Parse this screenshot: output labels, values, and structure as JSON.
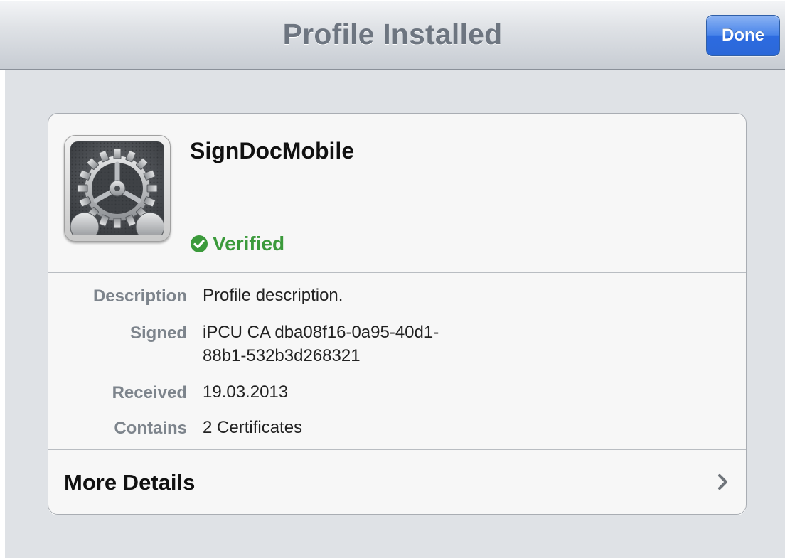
{
  "navbar": {
    "title": "Profile Installed",
    "done_label": "Done"
  },
  "profile": {
    "name": "SignDocMobile",
    "icon": "settings-gear-icon",
    "status": "Verified",
    "status_color": "#3b9a3b"
  },
  "details": {
    "rows": [
      {
        "label": "Description",
        "value": "Profile description."
      },
      {
        "label": "Signed",
        "value_line1": "iPCU CA dba08f16-0a95-40d1-",
        "value_line2": "88b1-532b3d268321"
      },
      {
        "label": "Received",
        "value": "19.03.2013"
      },
      {
        "label": "Contains",
        "value": "2 Certificates"
      }
    ]
  },
  "more_details": {
    "label": "More Details",
    "icon": "chevron-right-icon"
  },
  "colors": {
    "accent_blue": "#2d6be0",
    "background": "#dfe2e6"
  }
}
